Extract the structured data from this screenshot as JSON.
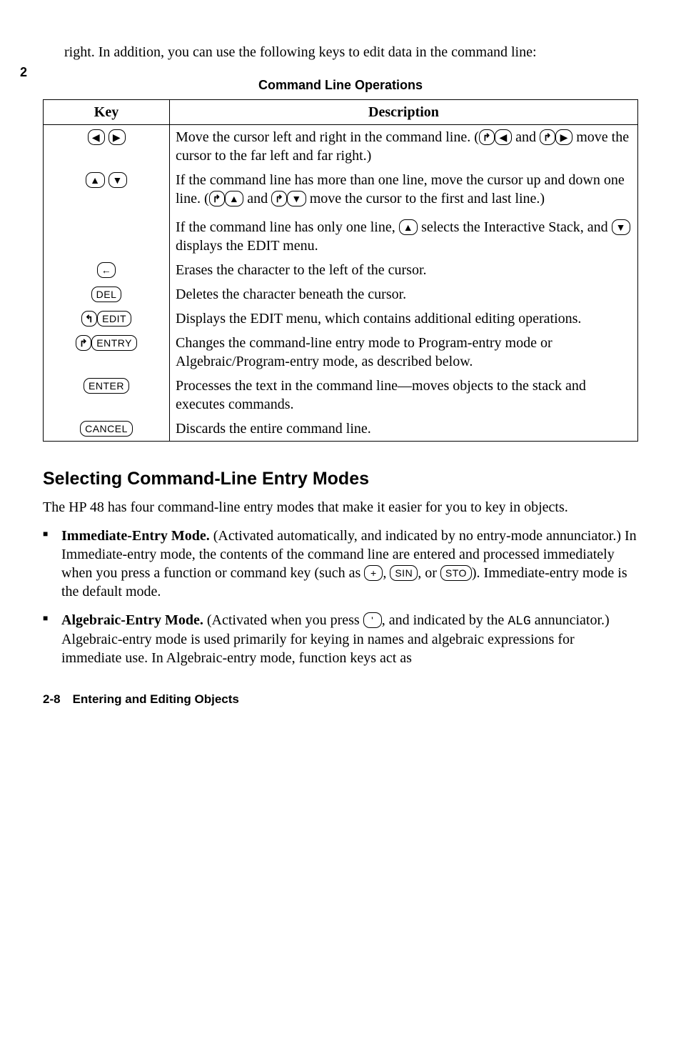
{
  "page_num": "2",
  "intro": "right. In addition, you can use the following keys to edit data in the command line:",
  "table_title": "Command Line Operations",
  "th_key": "Key",
  "th_desc": "Description",
  "rows": {
    "r0": {
      "key_a": "◀",
      "key_b": "▶",
      "desc_pre": "Move the cursor left and right in the command line. (",
      "shift1": "↱",
      "k1": "◀",
      "mid": " and ",
      "shift2": "↱",
      "k2": "▶",
      "desc_post": " move the cursor to the far left and far right.)"
    },
    "r1": {
      "key_a": "▲",
      "key_b": "▼",
      "desc_pre": "If the command line has more than one line, move the cursor up and down one line. (",
      "shift1": "↱",
      "k1": "▲",
      "mid": " and ",
      "shift2": "↱",
      "k2": "▼",
      "desc_post": " move the cursor to the first and last line.)",
      "sub_pre": "If the command line has only one line, ",
      "sub_k1": "▲",
      "sub_mid": " selects the Interactive Stack, and ",
      "sub_k2": "▼",
      "sub_post": " displays the EDIT menu."
    },
    "r2": {
      "key_a": "←",
      "desc": "Erases the character to the left of the cursor."
    },
    "r3": {
      "key_a": "DEL",
      "desc": "Deletes the character beneath the cursor."
    },
    "r4": {
      "shift": "↰",
      "key_a": "EDIT",
      "desc": "Displays the EDIT menu, which contains additional editing operations."
    },
    "r5": {
      "shift": "↱",
      "key_a": "ENTRY",
      "desc": "Changes the command-line entry mode to Program-entry mode or Algebraic/Program-entry mode, as described below."
    },
    "r6": {
      "key_a": "ENTER",
      "desc": "Processes the text in the command line—moves objects to the stack and executes commands."
    },
    "r7": {
      "key_a": "CANCEL",
      "desc": "Discards the entire command line."
    }
  },
  "section_heading": "Selecting Command-Line Entry Modes",
  "section_intro": "The HP 48 has four command-line entry modes that make it easier for you to key in objects.",
  "mode1": {
    "name": "Immediate-Entry Mode.",
    "pre": " (Activated automatically, and indicated by no entry-mode annunciator.) In Immediate-entry mode, the contents of the command line are entered and processed immediately when you press a function or command key (such as ",
    "k1": "+",
    "sep1": ", ",
    "k2": "SIN",
    "sep2": ", or ",
    "k3": "STO",
    "post": "). Immediate-entry mode is the default mode."
  },
  "mode2": {
    "name": "Algebraic-Entry Mode.",
    "pre": " (Activated when you press ",
    "k1": "'",
    "mid": ", and indicated by the ",
    "ann": "ALG",
    "post": " annunciator.) Algebraic-entry mode is used primarily for keying in names and algebraic expressions for immediate use. In Algebraic-entry mode, function keys act as"
  },
  "footer": "2-8 Entering and Editing Objects"
}
